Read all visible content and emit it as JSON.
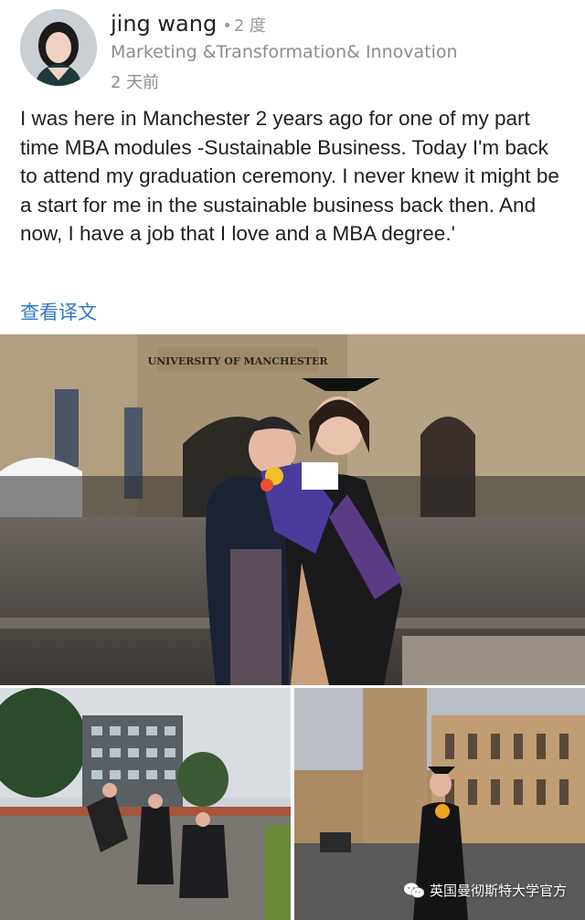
{
  "profile": {
    "name": "jing wang",
    "degree": "2 度",
    "headline": "Marketing &Transformation& Innovation",
    "time": "2 天前"
  },
  "post": {
    "text": "I was here in Manchester 2 years ago for one of my part time MBA modules -Sustainable Business. Today I'm back to attend my graduation ceremony.  I never knew it might be a start for me in the sustainable business back then. And now, I have a job that I love and a MBA degree.'",
    "translate_label": "查看译文"
  },
  "photo_main": {
    "sign_text": "UNIVERSITY OF MANCHESTER"
  },
  "watermark": {
    "text": "英国曼彻斯特大学官方"
  }
}
